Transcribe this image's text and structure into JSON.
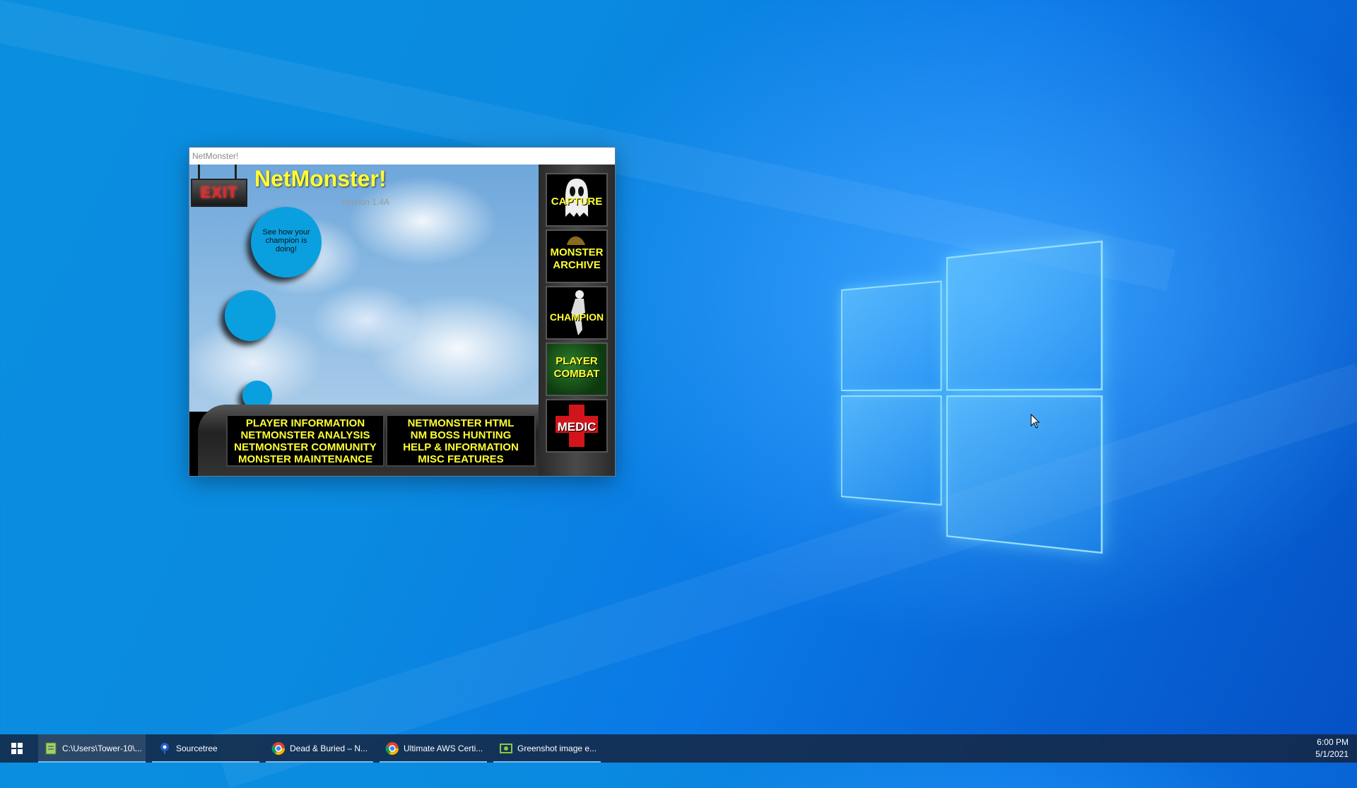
{
  "app": {
    "window_title": "NetMonster!",
    "title": "NetMonster!",
    "version": "Version 1.4A",
    "exit_label": "EXIT",
    "bubble_text": "See how your champion is doing!",
    "side_buttons": [
      {
        "line1": "CAPTURE",
        "line2": ""
      },
      {
        "line1": "MONSTER",
        "line2": "ARCHIVE"
      },
      {
        "line1": "CHAMPION",
        "line2": ""
      },
      {
        "line1": "PLAYER",
        "line2": "COMBAT"
      },
      {
        "line1": "MEDIC",
        "line2": ""
      }
    ],
    "menu_left": [
      "PLAYER INFORMATION",
      "NETMONSTER ANALYSIS",
      "NETMONSTER COMMUNITY",
      "MONSTER MAINTENANCE"
    ],
    "menu_right": [
      "NETMONSTER HTML",
      "NM BOSS HUNTING",
      "HELP & INFORMATION",
      "MISC FEATURES"
    ]
  },
  "taskbar": {
    "items": [
      {
        "label": "C:\\Users\\Tower-10\\...",
        "icon": "notepad-icon"
      },
      {
        "label": "Sourcetree",
        "icon": "sourcetree-icon"
      },
      {
        "label": "Dead & Buried – N...",
        "icon": "chrome-icon"
      },
      {
        "label": "Ultimate AWS Certi...",
        "icon": "chrome-icon"
      },
      {
        "label": "Greenshot image e...",
        "icon": "greenshot-icon"
      }
    ],
    "time": "6:00 PM",
    "date": "5/1/2021"
  },
  "colors": {
    "accent_yellow": "#ffff33",
    "desktop_blue": "#0a8ae0",
    "taskbar": "#142846"
  }
}
